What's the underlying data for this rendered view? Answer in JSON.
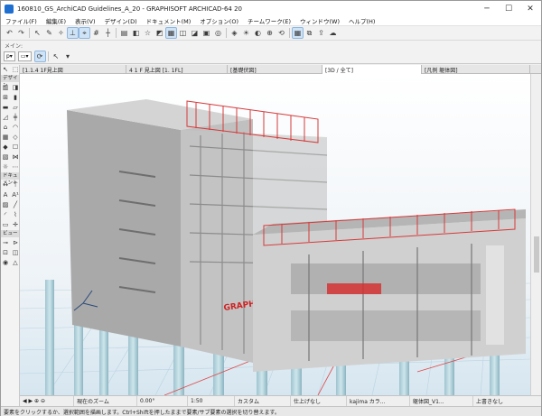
{
  "window": {
    "title": "160810_GS_ArchiCAD Guidelines_A_20 - GRAPHISOFT ARCHICAD-64 20",
    "minimize": "─",
    "maximize": "☐",
    "close": "✕"
  },
  "menu": [
    "ファイル(F)",
    "編集(E)",
    "表示(V)",
    "デザイン(D)",
    "ドキュメント(M)",
    "オプション(O)",
    "チームワーク(E)",
    "ウィンドウ(W)",
    "ヘルプ(H)"
  ],
  "toolbar_label": "メイン:",
  "tabs": [
    {
      "label": "[1.1.4 1F見上図"
    },
    {
      "label": "4 1 F 見上図 [1. 1FL]"
    },
    {
      "label": "[基礎伏図]"
    },
    {
      "label": "[3D / 全て]"
    },
    {
      "label": "[凡例 躯体図]"
    }
  ],
  "toolbox": {
    "design_label": "デザイン",
    "document_label": "ドキュメント",
    "view_label": "ビュー"
  },
  "model": {
    "brand_text": "GRAPHISOFT"
  },
  "viewbar": {
    "zoom_text": "現在のズーム",
    "angle": "0.00°",
    "scale": "1:50",
    "custom": "カスタム",
    "finish": "仕上げなし",
    "user": "kajima カラ...",
    "drawing": "躯体図_V1...",
    "override": "上書きなし"
  },
  "status": "要素をクリックするか、選択範囲を描画します。Ctrl+Shiftを押したままで要素/サブ要素の選択を切り替えます。"
}
